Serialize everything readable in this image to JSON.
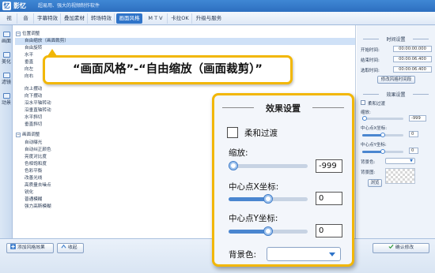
{
  "titlebar": {
    "app_name": "影忆",
    "subtitle": "超易用、强大的视频制作软件",
    "logo_letter": "忆"
  },
  "menu": {
    "items": [
      "视　频",
      "音　频",
      "字幕特效",
      "叠加素材",
      "转场特效",
      "画面风格",
      "M T V",
      "卡拉OK",
      "升级与服务"
    ],
    "active": "画面风格"
  },
  "left_tabs": [
    "画面",
    "美化",
    "滤镜",
    "动景"
  ],
  "style_list": {
    "group1_title": "位置调整",
    "group1_items": [
      "自由缩放（画面裁剪）",
      "自由旋转",
      "水平",
      "垂直",
      "向左",
      "向右",
      "向上摆动",
      "向下摆动",
      "沿水平轴转动",
      "沿垂直轴转动",
      "水平斜切",
      "垂直斜切"
    ],
    "selected": "自由缩放（画面裁剪）",
    "group2_title": "画面调整",
    "group2_items": [
      "自动曝光",
      "自动纠正颜色",
      "亮度对比度",
      "色相饱和度",
      "色彩平衡",
      "改善光线",
      "高质量去噪点",
      "锐化",
      "普通模糊",
      "强力高斯模糊"
    ]
  },
  "right_panel": {
    "time_section_title": "时间设置",
    "start_time_label": "开始时间:",
    "start_time_value": "00:00:00.000",
    "end_time_label": "结束时间:",
    "end_time_value": "00:00:06.400",
    "selected_time_label": "选取时间:",
    "selected_time_value": "00:00:06.400",
    "modify_time_button": "修改风格时间段",
    "effect_section_title": "效果设置",
    "soft_transition_label": "柔和过渡",
    "zoom_label": "缩放:",
    "zoom_value": "-999",
    "zoom_level": 0.0,
    "center_x_label": "中心点X坐标:",
    "center_x_value": "0",
    "center_x_level": 0.5,
    "center_y_label": "中心点Y坐标:",
    "center_y_value": "0",
    "center_y_level": 0.5,
    "bg_color_label": "背景色:",
    "bg_image_label": "背景图:",
    "browse_button": "浏览"
  },
  "bottom": {
    "add_style_button": "添加风格效果",
    "collapse_button": "收起",
    "confirm_button": "确认修改"
  },
  "callout": {
    "text": "“画面风格”-“自由缩放（画面裁剪）”"
  },
  "zoom_panel": {
    "title": "效果设置",
    "soft_transition_label": "柔和过渡",
    "zoom_label": "缩放:",
    "zoom_value": "-999",
    "center_x_label": "中心点X坐标:",
    "center_x_value": "0",
    "center_y_label": "中心点Y坐标:",
    "center_y_value": "0",
    "bg_color_label": "背景色:"
  },
  "colors": {
    "brand_blue": "#2f74c9",
    "highlight_yellow": "#f2b705",
    "selected_row": "#cfe1f7"
  },
  "icons": [
    "logo-icon",
    "add-icon",
    "collapse-icon",
    "confirm-icon",
    "dropdown-arrow-icon"
  ]
}
